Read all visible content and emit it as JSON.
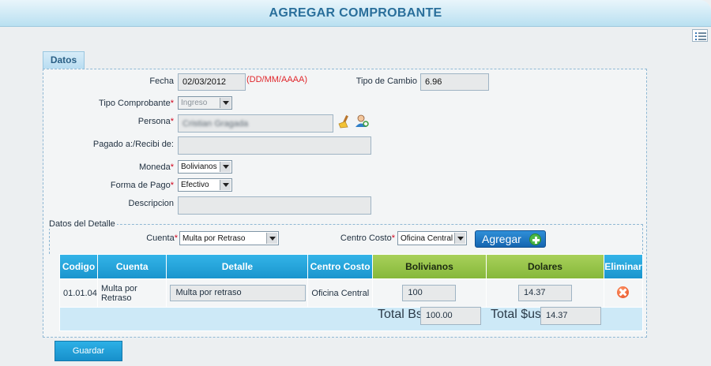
{
  "window": {
    "title": "AGREGAR COMPROBANTE"
  },
  "tab": {
    "label": "Datos"
  },
  "form": {
    "fecha": {
      "label": "Fecha",
      "value": "02/03/2012",
      "hint": "(DD/MM/AAAA)"
    },
    "tipo_cambio": {
      "label": "Tipo de Cambio",
      "value": "6.96"
    },
    "tipo_comprobante": {
      "label": "Tipo Comprobante",
      "value": "Ingreso"
    },
    "persona": {
      "label": "Persona",
      "value": "Cristian Gragada"
    },
    "pagado": {
      "label": "Pagado a:/Recibi de:",
      "value": ""
    },
    "moneda": {
      "label": "Moneda",
      "value": "Bolivianos"
    },
    "forma_pago": {
      "label": "Forma de Pago",
      "value": "Efectivo"
    },
    "descripcion": {
      "label": "Descripcion",
      "value": ""
    },
    "required_mark": "*"
  },
  "detalle": {
    "legend": "Datos del Detalle",
    "cuenta": {
      "label": "Cuenta",
      "value": "Multa por Retraso"
    },
    "centro_costo": {
      "label": "Centro Costo",
      "value": "Oficina Central"
    },
    "agregar_label": "Agregar"
  },
  "table": {
    "headers": [
      "Codigo",
      "Cuenta",
      "Detalle",
      "Centro Costo",
      "Bolivianos",
      "Dolares",
      "Eliminar"
    ],
    "rows": [
      {
        "codigo": "01.01.04",
        "cuenta": "Multa por Retraso",
        "detalle": "Multa por retraso",
        "centro": "Oficina Central",
        "bolivianos": "100",
        "dolares": "14.37"
      }
    ],
    "total_bs_label": "Total Bs",
    "total_bs": "100.00",
    "total_us_label": "Total $us",
    "total_us": "14.37"
  },
  "actions": {
    "guardar_label": "Guardar"
  },
  "icons": {
    "clear": "broom-icon",
    "person": "person-search-icon",
    "list": "list-view-icon",
    "delete": "delete-icon",
    "add": "plus-icon"
  }
}
